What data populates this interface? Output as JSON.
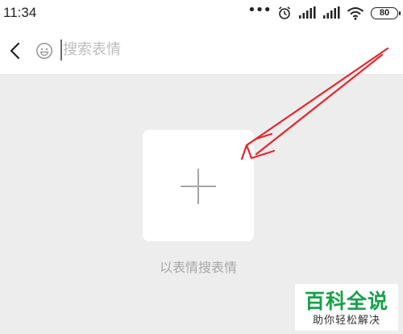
{
  "status_bar": {
    "time": "11:34",
    "more_indicator": "•••",
    "battery_level": "80",
    "icons": [
      "alarm-icon",
      "signal-icon",
      "signal-icon",
      "wifi-icon",
      "battery-icon"
    ]
  },
  "header": {
    "back_icon": "chevron-left-icon",
    "emoji_icon": "smiley-icon",
    "search": {
      "value": "",
      "placeholder": "搜索表情"
    }
  },
  "main": {
    "add_icon": "plus-icon",
    "caption": "以表情搜表情"
  },
  "watermark": {
    "title": "百科全说",
    "subtitle": "助你轻松解决"
  },
  "colors": {
    "page_background": "#ededed",
    "annotation_arrow": "#e8262b",
    "watermark_green": "#17a14a"
  }
}
